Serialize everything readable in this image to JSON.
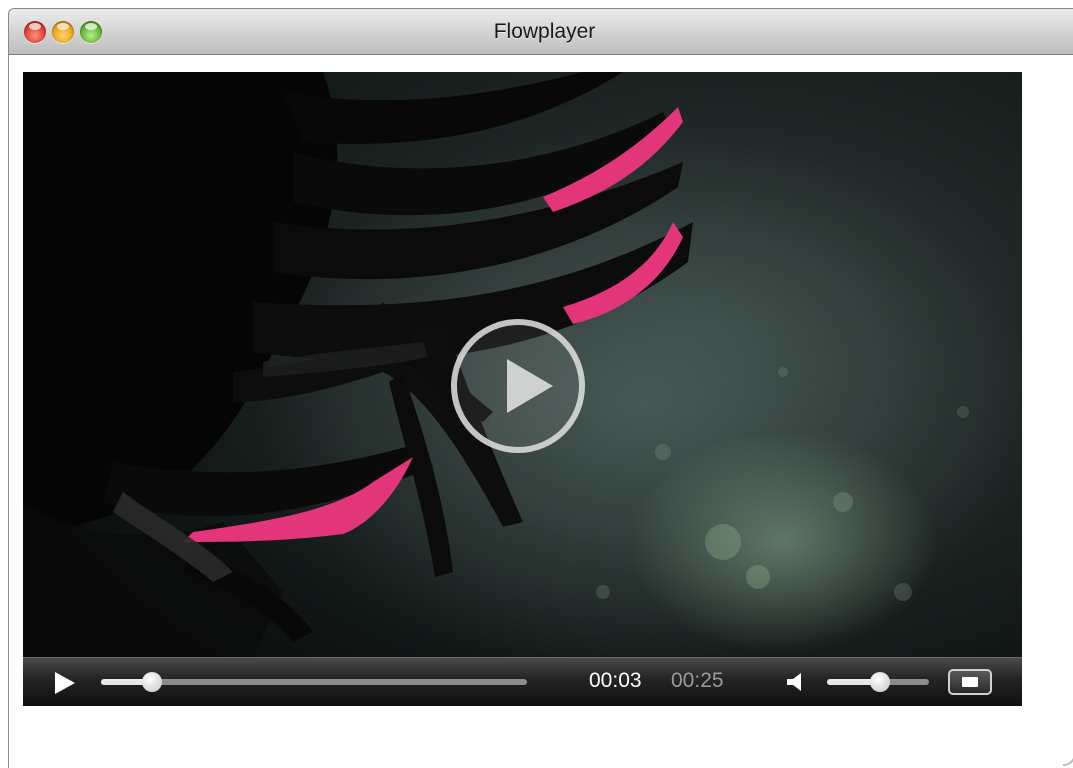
{
  "window": {
    "title": "Flowplayer"
  },
  "player": {
    "current_time": "00:03",
    "duration": "00:25",
    "progress_fraction": 0.12,
    "volume_fraction": 0.52
  },
  "icons": {
    "close": "close-button",
    "minimize": "minimize-button",
    "zoom": "zoom-button",
    "big_play": "play-circle-icon",
    "play": "play-icon",
    "volume": "speaker-icon",
    "fullscreen": "fullscreen-icon"
  },
  "colors": {
    "accent_pink": "#e2357a",
    "controlbar": "#1c1c1c"
  }
}
